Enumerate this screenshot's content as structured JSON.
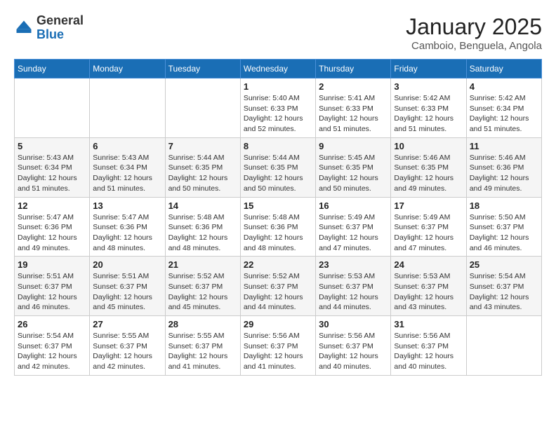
{
  "header": {
    "logo_general": "General",
    "logo_blue": "Blue",
    "month_title": "January 2025",
    "location": "Camboio, Benguela, Angola"
  },
  "weekdays": [
    "Sunday",
    "Monday",
    "Tuesday",
    "Wednesday",
    "Thursday",
    "Friday",
    "Saturday"
  ],
  "weeks": [
    [
      {
        "day": "",
        "info": ""
      },
      {
        "day": "",
        "info": ""
      },
      {
        "day": "",
        "info": ""
      },
      {
        "day": "1",
        "info": "Sunrise: 5:40 AM\nSunset: 6:33 PM\nDaylight: 12 hours\nand 52 minutes."
      },
      {
        "day": "2",
        "info": "Sunrise: 5:41 AM\nSunset: 6:33 PM\nDaylight: 12 hours\nand 51 minutes."
      },
      {
        "day": "3",
        "info": "Sunrise: 5:42 AM\nSunset: 6:33 PM\nDaylight: 12 hours\nand 51 minutes."
      },
      {
        "day": "4",
        "info": "Sunrise: 5:42 AM\nSunset: 6:34 PM\nDaylight: 12 hours\nand 51 minutes."
      }
    ],
    [
      {
        "day": "5",
        "info": "Sunrise: 5:43 AM\nSunset: 6:34 PM\nDaylight: 12 hours\nand 51 minutes."
      },
      {
        "day": "6",
        "info": "Sunrise: 5:43 AM\nSunset: 6:34 PM\nDaylight: 12 hours\nand 51 minutes."
      },
      {
        "day": "7",
        "info": "Sunrise: 5:44 AM\nSunset: 6:35 PM\nDaylight: 12 hours\nand 50 minutes."
      },
      {
        "day": "8",
        "info": "Sunrise: 5:44 AM\nSunset: 6:35 PM\nDaylight: 12 hours\nand 50 minutes."
      },
      {
        "day": "9",
        "info": "Sunrise: 5:45 AM\nSunset: 6:35 PM\nDaylight: 12 hours\nand 50 minutes."
      },
      {
        "day": "10",
        "info": "Sunrise: 5:46 AM\nSunset: 6:35 PM\nDaylight: 12 hours\nand 49 minutes."
      },
      {
        "day": "11",
        "info": "Sunrise: 5:46 AM\nSunset: 6:36 PM\nDaylight: 12 hours\nand 49 minutes."
      }
    ],
    [
      {
        "day": "12",
        "info": "Sunrise: 5:47 AM\nSunset: 6:36 PM\nDaylight: 12 hours\nand 49 minutes."
      },
      {
        "day": "13",
        "info": "Sunrise: 5:47 AM\nSunset: 6:36 PM\nDaylight: 12 hours\nand 48 minutes."
      },
      {
        "day": "14",
        "info": "Sunrise: 5:48 AM\nSunset: 6:36 PM\nDaylight: 12 hours\nand 48 minutes."
      },
      {
        "day": "15",
        "info": "Sunrise: 5:48 AM\nSunset: 6:36 PM\nDaylight: 12 hours\nand 48 minutes."
      },
      {
        "day": "16",
        "info": "Sunrise: 5:49 AM\nSunset: 6:37 PM\nDaylight: 12 hours\nand 47 minutes."
      },
      {
        "day": "17",
        "info": "Sunrise: 5:49 AM\nSunset: 6:37 PM\nDaylight: 12 hours\nand 47 minutes."
      },
      {
        "day": "18",
        "info": "Sunrise: 5:50 AM\nSunset: 6:37 PM\nDaylight: 12 hours\nand 46 minutes."
      }
    ],
    [
      {
        "day": "19",
        "info": "Sunrise: 5:51 AM\nSunset: 6:37 PM\nDaylight: 12 hours\nand 46 minutes."
      },
      {
        "day": "20",
        "info": "Sunrise: 5:51 AM\nSunset: 6:37 PM\nDaylight: 12 hours\nand 45 minutes."
      },
      {
        "day": "21",
        "info": "Sunrise: 5:52 AM\nSunset: 6:37 PM\nDaylight: 12 hours\nand 45 minutes."
      },
      {
        "day": "22",
        "info": "Sunrise: 5:52 AM\nSunset: 6:37 PM\nDaylight: 12 hours\nand 44 minutes."
      },
      {
        "day": "23",
        "info": "Sunrise: 5:53 AM\nSunset: 6:37 PM\nDaylight: 12 hours\nand 44 minutes."
      },
      {
        "day": "24",
        "info": "Sunrise: 5:53 AM\nSunset: 6:37 PM\nDaylight: 12 hours\nand 43 minutes."
      },
      {
        "day": "25",
        "info": "Sunrise: 5:54 AM\nSunset: 6:37 PM\nDaylight: 12 hours\nand 43 minutes."
      }
    ],
    [
      {
        "day": "26",
        "info": "Sunrise: 5:54 AM\nSunset: 6:37 PM\nDaylight: 12 hours\nand 42 minutes."
      },
      {
        "day": "27",
        "info": "Sunrise: 5:55 AM\nSunset: 6:37 PM\nDaylight: 12 hours\nand 42 minutes."
      },
      {
        "day": "28",
        "info": "Sunrise: 5:55 AM\nSunset: 6:37 PM\nDaylight: 12 hours\nand 41 minutes."
      },
      {
        "day": "29",
        "info": "Sunrise: 5:56 AM\nSunset: 6:37 PM\nDaylight: 12 hours\nand 41 minutes."
      },
      {
        "day": "30",
        "info": "Sunrise: 5:56 AM\nSunset: 6:37 PM\nDaylight: 12 hours\nand 40 minutes."
      },
      {
        "day": "31",
        "info": "Sunrise: 5:56 AM\nSunset: 6:37 PM\nDaylight: 12 hours\nand 40 minutes."
      },
      {
        "day": "",
        "info": ""
      }
    ]
  ]
}
